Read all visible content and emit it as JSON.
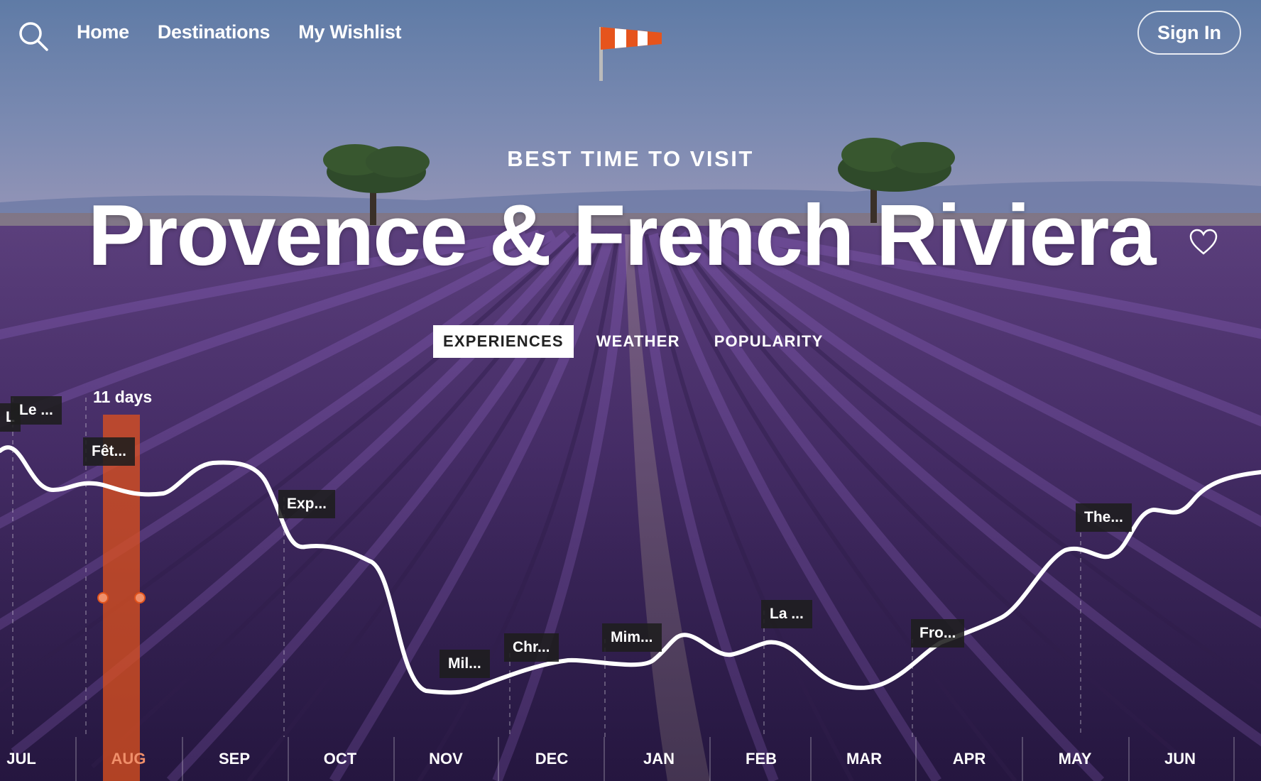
{
  "nav": {
    "links": [
      "Home",
      "Destinations",
      "My Wishlist"
    ],
    "sign_in": "Sign In",
    "search_icon": "search-icon",
    "logo_icon": "windsock-logo"
  },
  "hero": {
    "subtitle": "BEST TIME TO VISIT",
    "title": "Provence & French Riviera",
    "heart_icon": "heart-outline-icon"
  },
  "tabs": [
    {
      "label": "EXPERIENCES",
      "active": true
    },
    {
      "label": "WEATHER",
      "active": false
    },
    {
      "label": "POPULARITY",
      "active": false
    }
  ],
  "timeline": {
    "selection_label": "11 days",
    "selected_month": "AUG",
    "months": [
      "JUL",
      "AUG",
      "SEP",
      "OCT",
      "NOV",
      "DEC",
      "JAN",
      "FEB",
      "MAR",
      "APR",
      "MAY",
      "JUN"
    ],
    "tags": [
      "Le ...",
      "L",
      "Fêt...",
      "Exp...",
      "Mil...",
      "Chr...",
      "Mim...",
      "La ...",
      "Fro...",
      "The..."
    ],
    "accent_color": "#e0521c"
  }
}
